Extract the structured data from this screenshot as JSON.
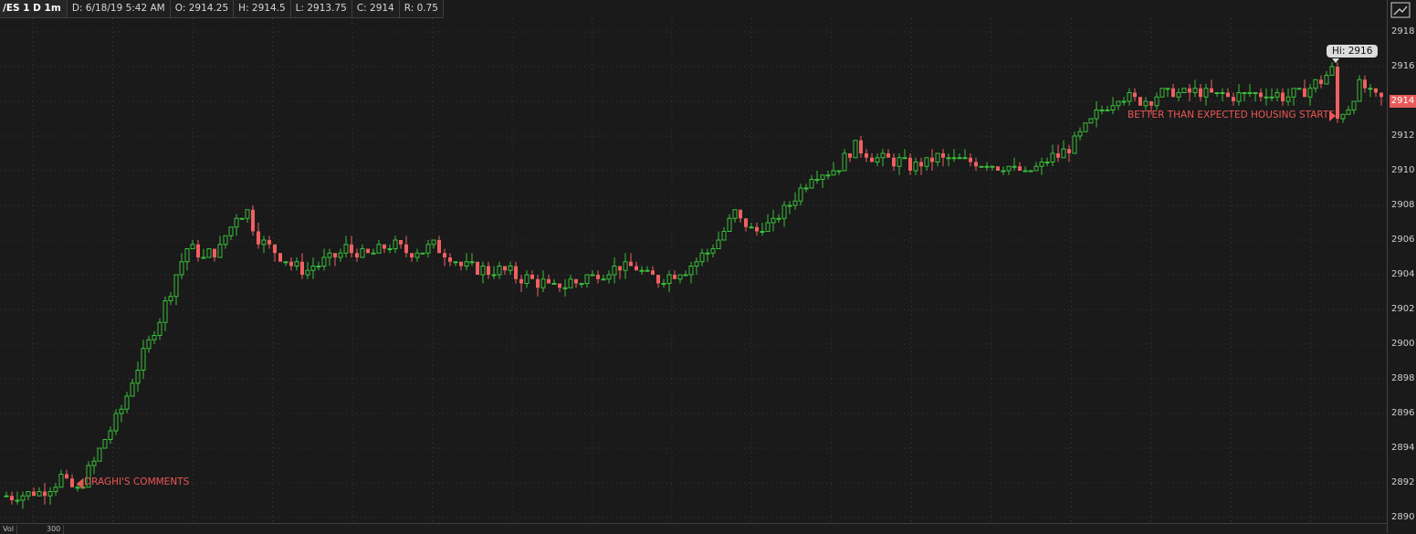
{
  "header": {
    "symbol": "/ES 1 D 1m",
    "date": "D: 6/18/19 5:42 AM",
    "open": "O: 2914.25",
    "high": "H: 2914.5",
    "low": "L: 2913.75",
    "close": "C: 2914",
    "range": "R: 0.75"
  },
  "axis": {
    "ticks": [
      "2918",
      "2916",
      "2914",
      "2912",
      "2910",
      "2908",
      "2906",
      "2904",
      "2902",
      "2900",
      "2898",
      "2896",
      "2894",
      "2892",
      "2890"
    ],
    "current_price": "2914"
  },
  "annotations": {
    "hi_label": "Hi: 2916",
    "draghi": "DRAGHI'S COMMENTS",
    "housing": "BETTER THAN EXPECTED HOUSING STARTS"
  },
  "bottom": {
    "left_label": "Vol",
    "value_label": "300"
  },
  "colors": {
    "up": "#3bbf3b",
    "down": "#f06060",
    "grid": "#3a3a3a",
    "background": "#1a1a1a"
  },
  "chart_data": {
    "type": "candlestick",
    "title": "/ES 1 D 1m",
    "ylim": [
      2889.75,
      2918.5
    ],
    "grid": true,
    "close_path": [
      [
        0,
        2891.25
      ],
      [
        6,
        2891.5
      ],
      [
        10,
        2892.25
      ],
      [
        13,
        2891.5
      ],
      [
        16,
        2893.25
      ],
      [
        19,
        2895.0
      ],
      [
        22,
        2897.0
      ],
      [
        25,
        2899.5
      ],
      [
        28,
        2901.5
      ],
      [
        31,
        2904.0
      ],
      [
        33,
        2905.5
      ],
      [
        36,
        2905.0
      ],
      [
        39,
        2905.5
      ],
      [
        42,
        2907.5
      ],
      [
        44,
        2907.75
      ],
      [
        46,
        2906.0
      ],
      [
        50,
        2905.0
      ],
      [
        54,
        2904.25
      ],
      [
        58,
        2904.75
      ],
      [
        62,
        2905.5
      ],
      [
        66,
        2905.0
      ],
      [
        70,
        2905.75
      ],
      [
        74,
        2905.25
      ],
      [
        78,
        2905.75
      ],
      [
        82,
        2904.75
      ],
      [
        86,
        2904.25
      ],
      [
        90,
        2904.25
      ],
      [
        95,
        2903.75
      ],
      [
        100,
        2903.25
      ],
      [
        105,
        2903.75
      ],
      [
        110,
        2904.25
      ],
      [
        114,
        2904.5
      ],
      [
        118,
        2903.75
      ],
      [
        122,
        2904.0
      ],
      [
        126,
        2904.75
      ],
      [
        130,
        2906.0
      ],
      [
        133,
        2907.5
      ],
      [
        136,
        2906.5
      ],
      [
        140,
        2907.0
      ],
      [
        144,
        2908.5
      ],
      [
        147,
        2909.75
      ],
      [
        151,
        2910.0
      ],
      [
        155,
        2911.5
      ],
      [
        158,
        2910.75
      ],
      [
        162,
        2910.5
      ],
      [
        166,
        2910.25
      ],
      [
        170,
        2910.75
      ],
      [
        174,
        2910.5
      ],
      [
        178,
        2910.5
      ],
      [
        182,
        2910.25
      ],
      [
        186,
        2909.75
      ],
      [
        190,
        2910.5
      ],
      [
        194,
        2911.25
      ],
      [
        197,
        2912.5
      ],
      [
        200,
        2913.5
      ],
      [
        203,
        2914.25
      ],
      [
        207,
        2914.0
      ],
      [
        212,
        2914.5
      ],
      [
        218,
        2914.5
      ],
      [
        224,
        2914.25
      ],
      [
        230,
        2914.5
      ],
      [
        234,
        2914.25
      ],
      [
        238,
        2914.75
      ],
      [
        240,
        2915.25
      ],
      [
        242,
        2915.75
      ],
      [
        243,
        2913.0
      ],
      [
        245,
        2913.75
      ],
      [
        247,
        2915.0
      ],
      [
        249,
        2914.5
      ],
      [
        251,
        2914.0
      ]
    ]
  }
}
